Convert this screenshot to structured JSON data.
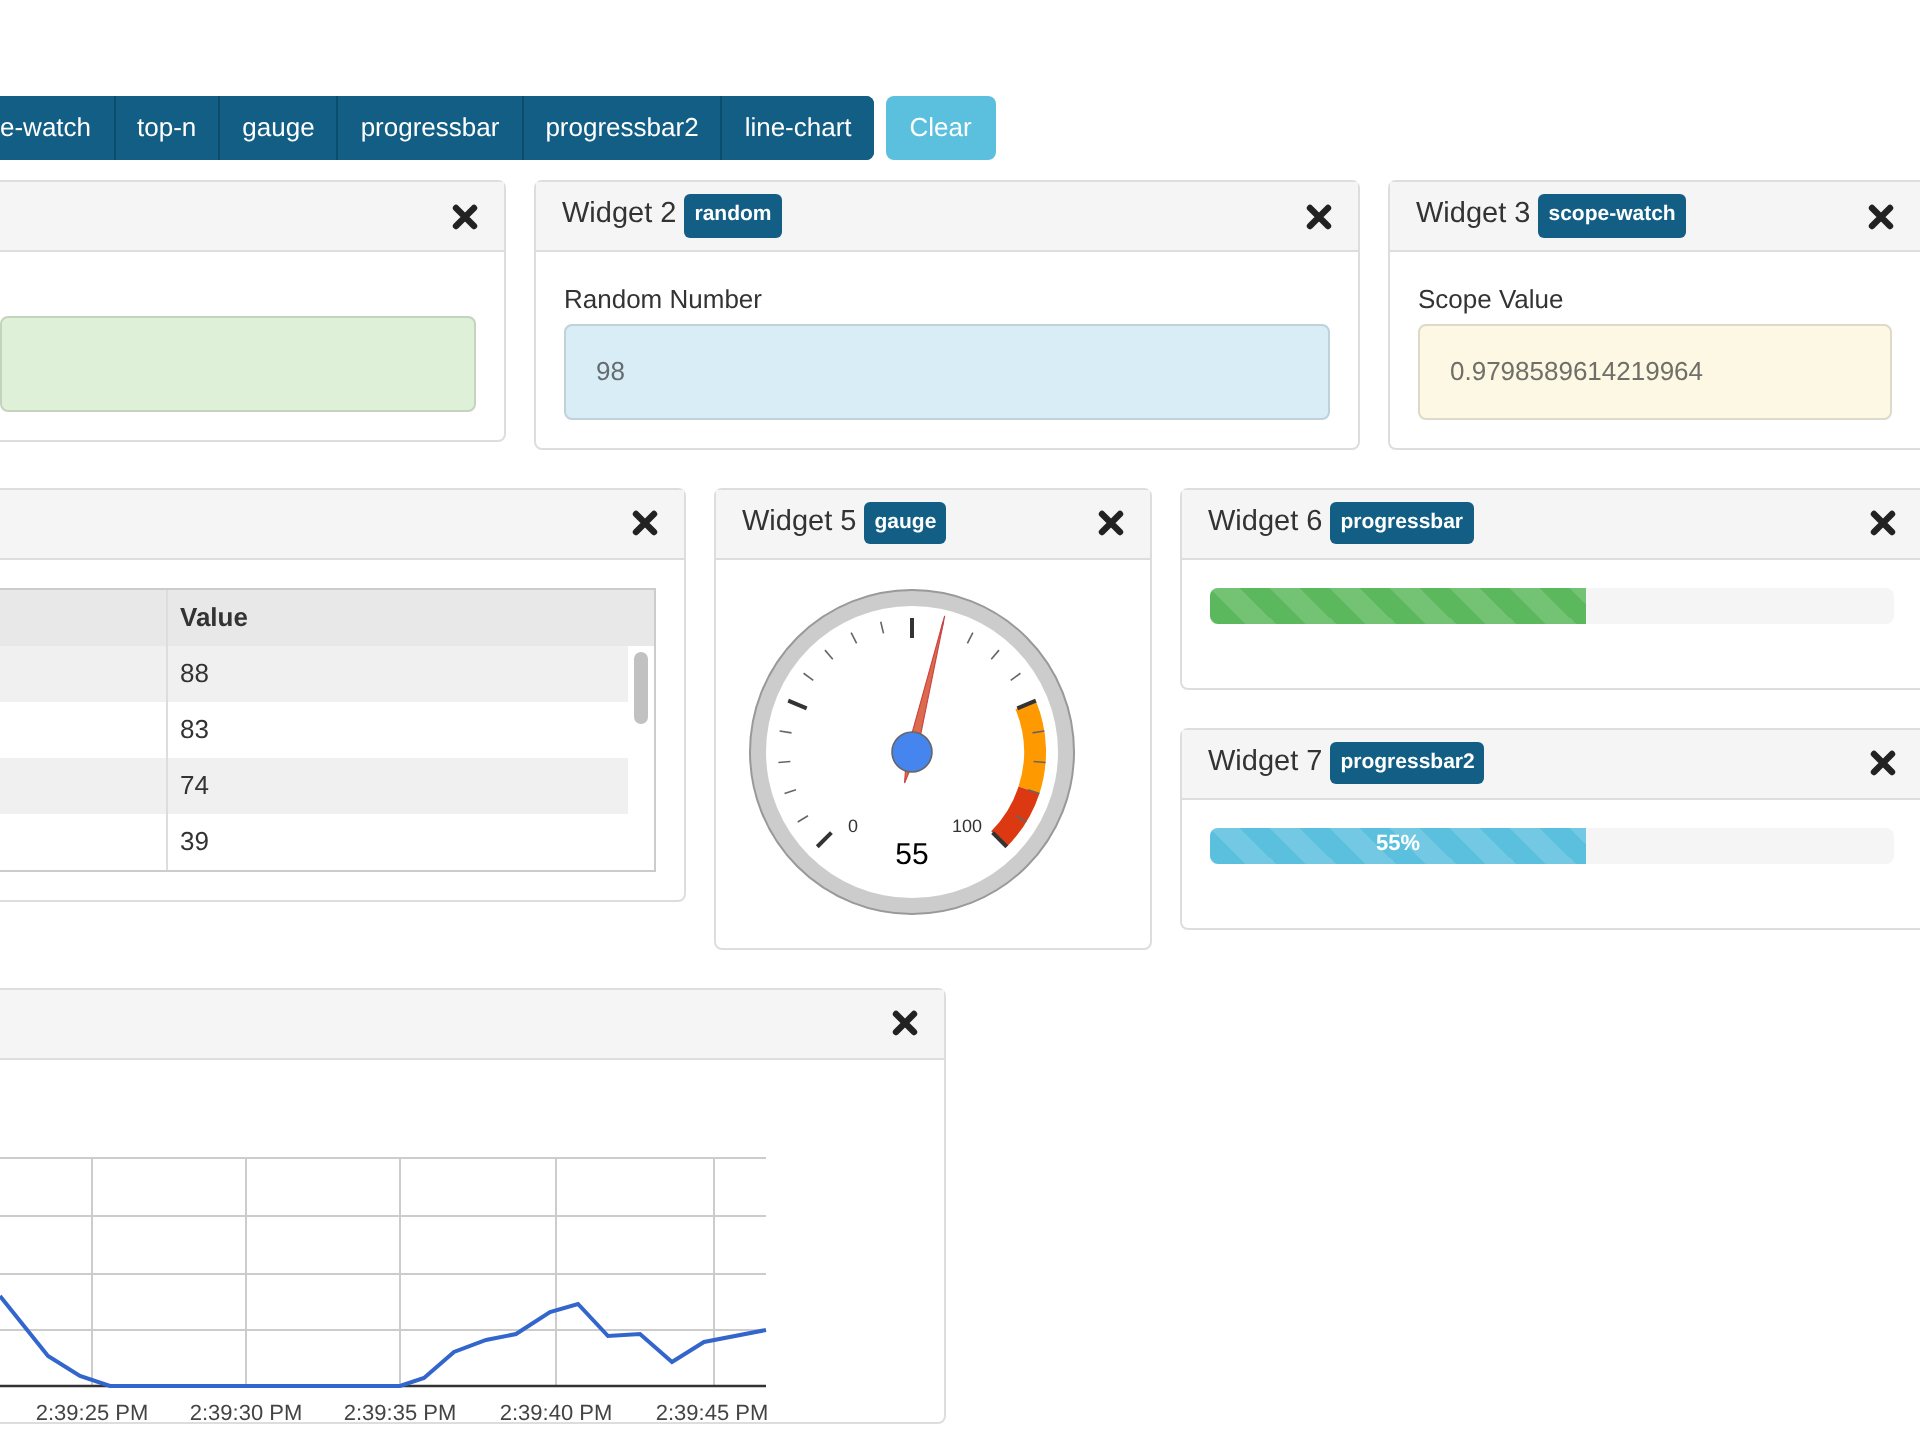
{
  "toolbar": {
    "buttons": [
      "e-watch",
      "top-n",
      "gauge",
      "progressbar",
      "progressbar2",
      "line-chart"
    ],
    "clear": "Clear"
  },
  "widgets": [
    {
      "kind": "field",
      "color": "#dff0d8"
    },
    {
      "kind": "field",
      "title": "Widget 2",
      "tag": "random",
      "label": "Random Number",
      "value": "98",
      "color": "#d9edf7"
    },
    {
      "kind": "field",
      "title": "Widget 3",
      "tag": "scope-watch",
      "label": "Scope Value",
      "value": "0.9798589614219964",
      "color": "#fcf8e3"
    },
    {
      "kind": "table",
      "columns": [
        "Value"
      ],
      "rows": [
        "88",
        "83",
        "74",
        "39"
      ]
    },
    {
      "kind": "gauge",
      "title": "Widget 5",
      "tag": "gauge",
      "level": 0.55,
      "min_label": "0",
      "max_label": "100",
      "value": "55"
    },
    {
      "kind": "progress",
      "title": "Widget 6",
      "tag": "progressbar",
      "level": 0.55,
      "color": "#5cb85c"
    },
    {
      "kind": "progress",
      "title": "Widget 7",
      "tag": "progressbar2",
      "level": 0.55,
      "color": "#5bc0de",
      "text": "55%"
    },
    {
      "kind": "chart",
      "x_labels": [
        "2:39:25 PM",
        "2:39:30 PM",
        "2:39:35 PM",
        "2:39:40 PM",
        "2:39:45 PM"
      ]
    }
  ]
}
